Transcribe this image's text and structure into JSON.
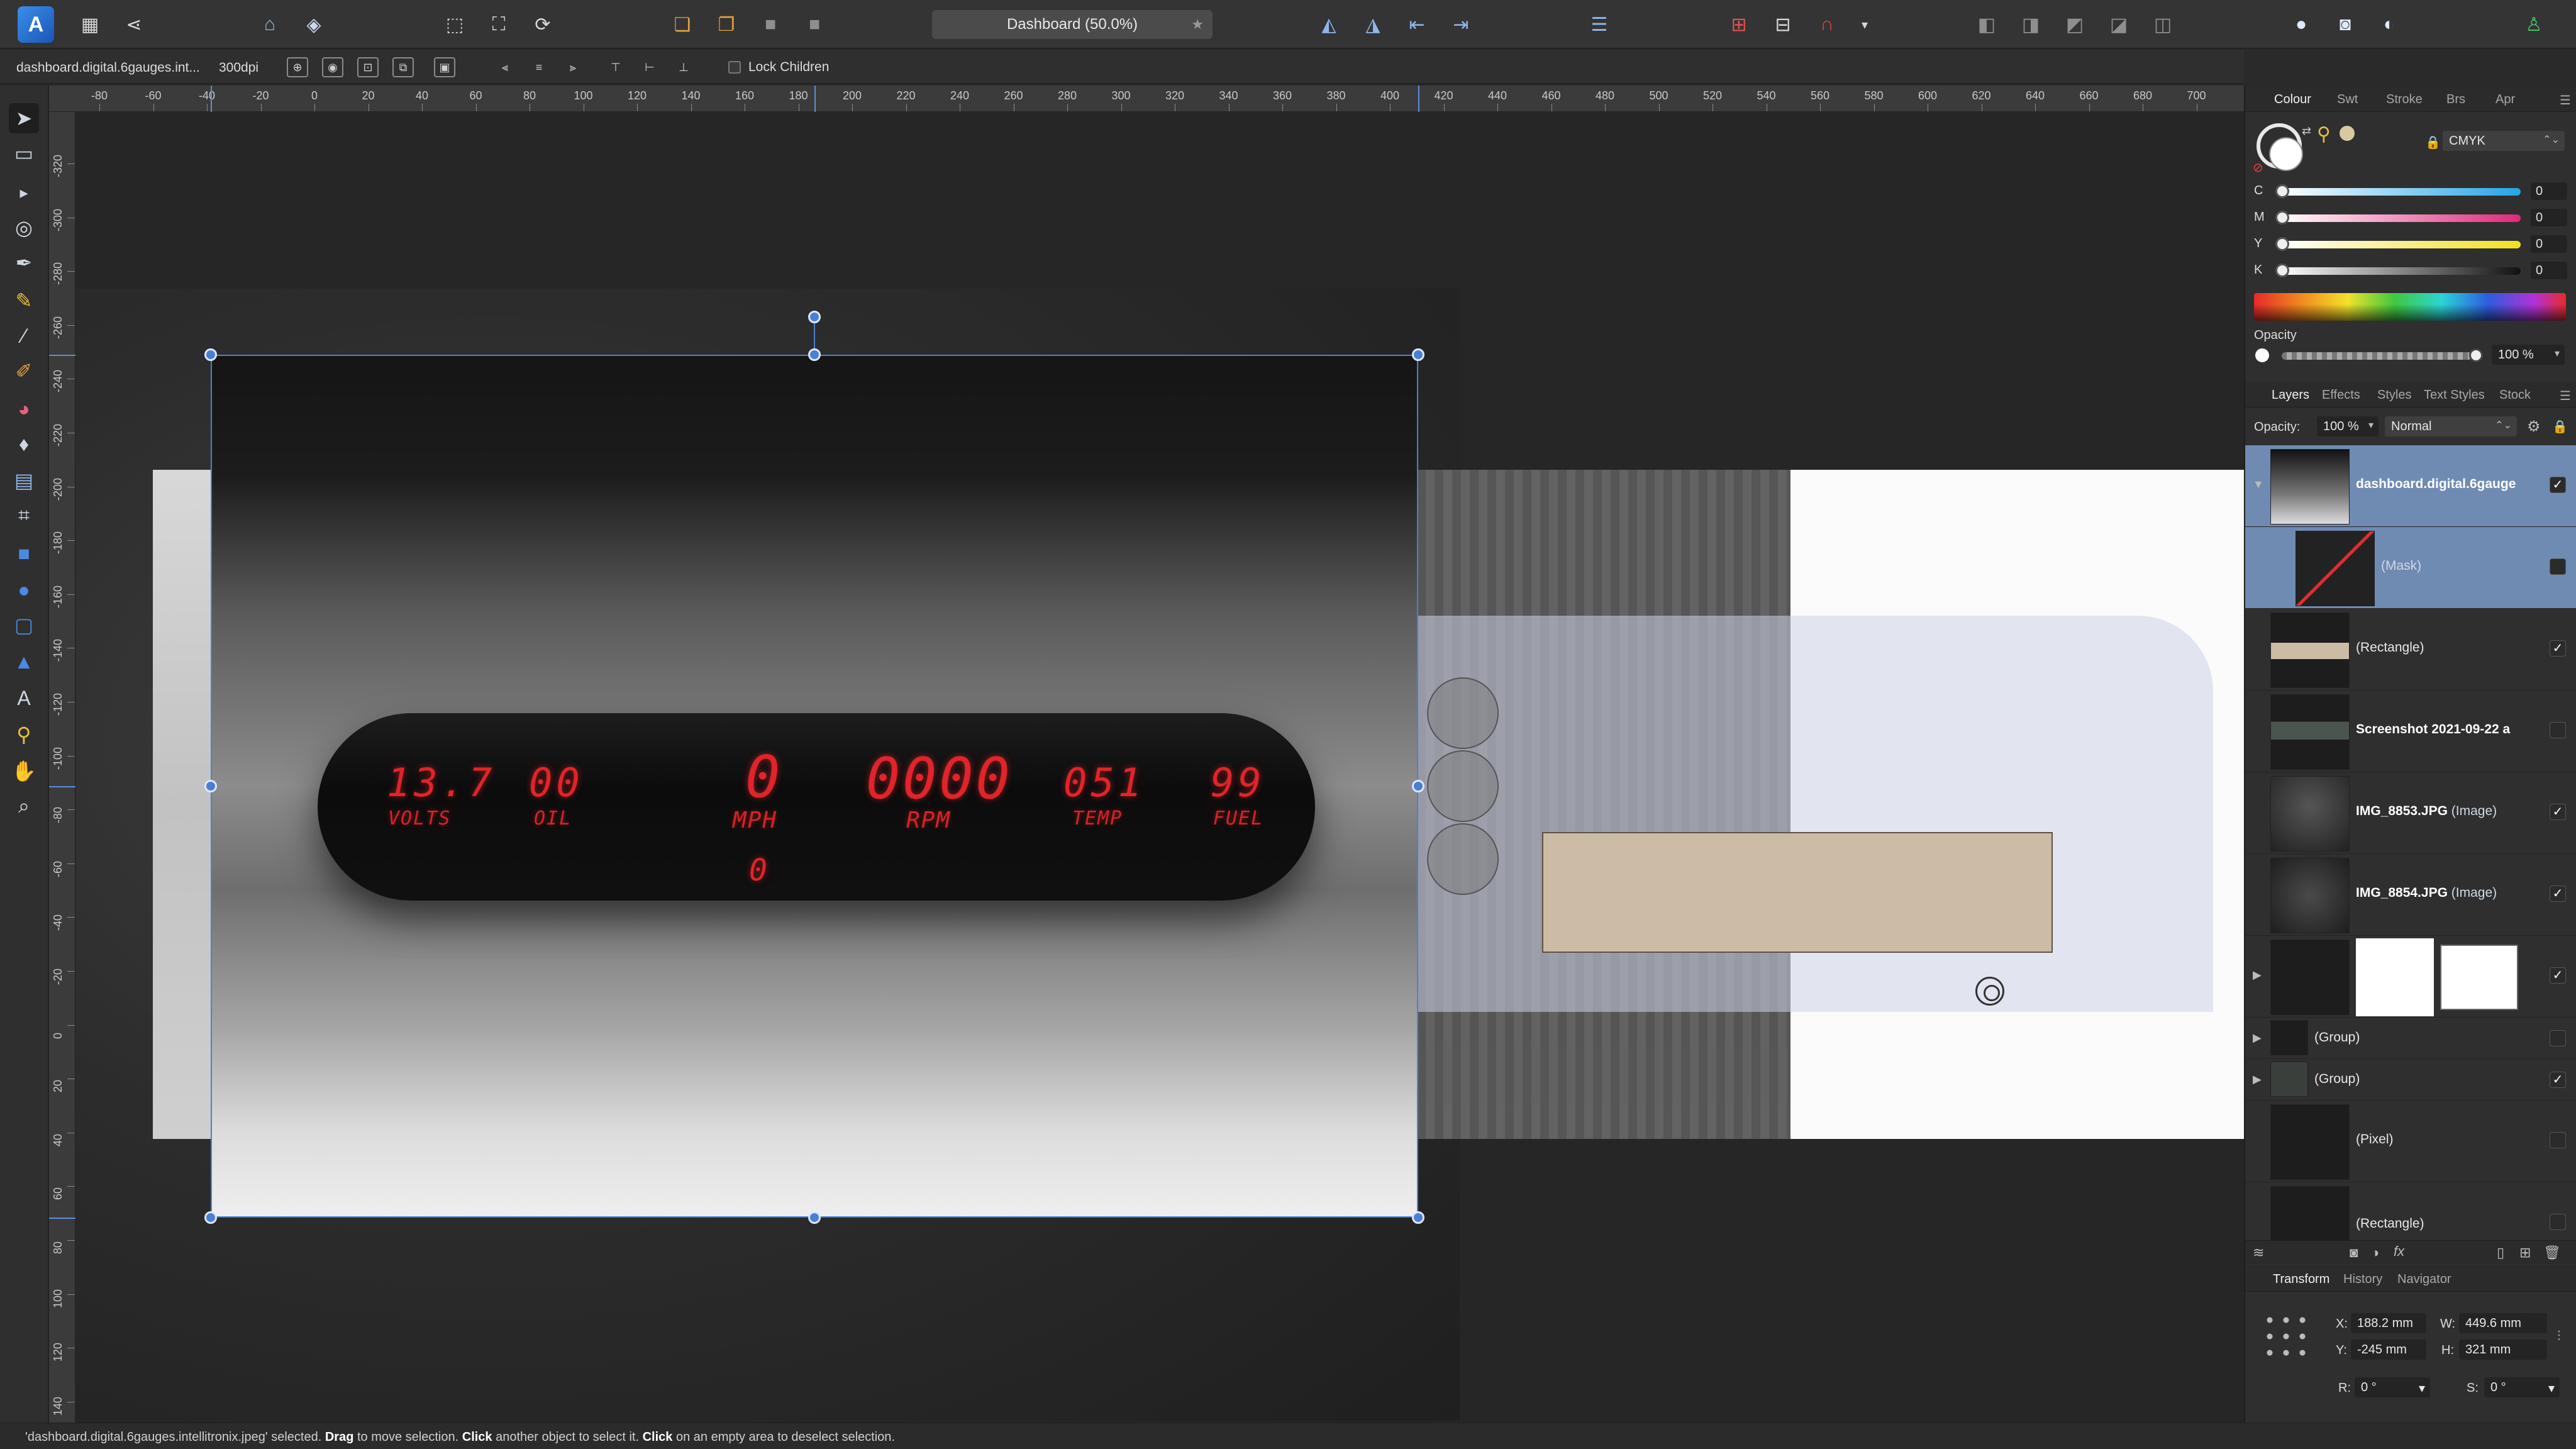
{
  "toolbar": {
    "document_title": "Dashboard (50.0%)",
    "favorite_icon": "star-icon"
  },
  "context": {
    "file_name": "dashboard.digital.6gauges.int...",
    "dpi": "300dpi",
    "lock_children_label": "Lock Children"
  },
  "ruler": {
    "unit": "mm",
    "top_labels": [
      "-80",
      "-60",
      "-40",
      "-20",
      "0",
      "20",
      "40",
      "60",
      "80",
      "100",
      "120",
      "140",
      "160",
      "180",
      "200",
      "220",
      "240",
      "260",
      "280",
      "300",
      "320",
      "340",
      "360",
      "380",
      "400",
      "420",
      "440",
      "460",
      "480",
      "500",
      "520",
      "540",
      "560",
      "580",
      "600",
      "620",
      "640",
      "660",
      "680",
      "700"
    ],
    "left_labels": [
      "-320",
      "-300",
      "-280",
      "-260",
      "-240",
      "-220",
      "-200",
      "-180",
      "-160",
      "-140",
      "-120",
      "-100",
      "-80",
      "-60",
      "-40",
      "-20",
      "0",
      "20",
      "40",
      "60",
      "80",
      "100",
      "120",
      "140"
    ]
  },
  "dashboard": {
    "volts_value": "13.7",
    "volts_label": "VOLTS",
    "oil_value": "00",
    "oil_label": "OIL",
    "mph_value": "0",
    "mph_label": "MPH",
    "odometer_value": "0",
    "rpm_value": "0000",
    "rpm_label": "RPM",
    "temp_value": "051",
    "temp_label": "TEMP",
    "fuel_value": "99",
    "fuel_label": "FUEL"
  },
  "colour_panel": {
    "tabs": [
      "Colour",
      "Swt",
      "Stroke",
      "Brs",
      "Apr"
    ],
    "active_tab": "Colour",
    "model": "CMYK",
    "channels": [
      {
        "label": "C",
        "value": "0"
      },
      {
        "label": "M",
        "value": "0"
      },
      {
        "label": "Y",
        "value": "0"
      },
      {
        "label": "K",
        "value": "0"
      }
    ],
    "opacity_label": "Opacity",
    "opacity_value": "100 %"
  },
  "layers_panel": {
    "tabs": [
      "Layers",
      "Effects",
      "Styles",
      "Text Styles",
      "Stock"
    ],
    "active_tab": "Layers",
    "opacity_label": "Opacity:",
    "opacity_value": "100 %",
    "blend_mode": "Normal",
    "layers": [
      {
        "name": "dashboard.digital.6gauge",
        "type": "",
        "visible": true,
        "selected": true
      },
      {
        "name": "(Mask)",
        "type": "",
        "visible": false,
        "selected": true
      },
      {
        "name": "(Rectangle)",
        "type": "",
        "visible": true,
        "selected": false
      },
      {
        "name": "Screenshot 2021-09-22 a",
        "type": "",
        "visible": false,
        "selected": false
      },
      {
        "name": "IMG_8853.JPG",
        "type": "(Image)",
        "visible": true,
        "selected": false
      },
      {
        "name": "IMG_8854.JPG",
        "type": "(Image)",
        "visible": true,
        "selected": false
      },
      {
        "name": "",
        "type": "",
        "visible": true,
        "selected": false
      },
      {
        "name": "(Group)",
        "type": "",
        "visible": false,
        "selected": false
      },
      {
        "name": "(Group)",
        "type": "",
        "visible": true,
        "selected": false
      },
      {
        "name": "(Pixel)",
        "type": "",
        "visible": false,
        "selected": false
      },
      {
        "name": "(Rectangle)",
        "type": "",
        "visible": false,
        "selected": false
      }
    ]
  },
  "transform_panel": {
    "tabs": [
      "Transform",
      "History",
      "Navigator"
    ],
    "active_tab": "Transform",
    "x_label": "X:",
    "x_value": "188.2 mm",
    "y_label": "Y:",
    "y_value": "-245 mm",
    "w_label": "W:",
    "w_value": "449.6 mm",
    "h_label": "H:",
    "h_value": "321 mm",
    "r_label": "R:",
    "r_value": "0 °",
    "s_label": "S:",
    "s_value": "0 °"
  },
  "status": {
    "selected_name": "'dashboard.digital.6gauges.intellitronix.jpeg' selected.",
    "drag": "Drag",
    "drag_text": "to move selection.",
    "click": "Click",
    "click_text": "another object to select it.",
    "click2": "Click",
    "click2_text": "on an empty area to deselect selection."
  }
}
